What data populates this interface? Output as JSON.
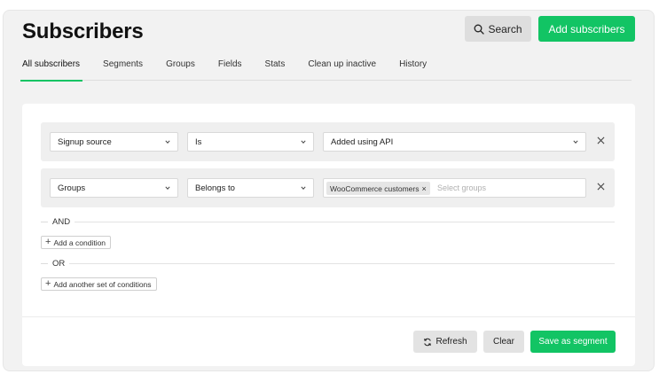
{
  "header": {
    "title": "Subscribers",
    "search_label": "Search",
    "add_label": "Add subscribers"
  },
  "tabs": [
    {
      "label": "All subscribers",
      "active": true
    },
    {
      "label": "Segments"
    },
    {
      "label": "Groups"
    },
    {
      "label": "Fields"
    },
    {
      "label": "Stats"
    },
    {
      "label": "Clean up inactive"
    },
    {
      "label": "History"
    }
  ],
  "conditions": [
    {
      "field": "Signup source",
      "operator": "Is",
      "value": "Added using API"
    },
    {
      "field": "Groups",
      "operator": "Belongs to",
      "tag": "WooCommerce customers",
      "placeholder": "Select groups"
    }
  ],
  "logic": {
    "and_label": "AND",
    "add_condition": "Add a condition",
    "or_label": "OR",
    "add_set": "Add another set of conditions"
  },
  "footer": {
    "refresh_label": "Refresh",
    "clear_label": "Clear",
    "save_label": "Save as segment"
  },
  "colors": {
    "accent": "#12c464",
    "background": "#f2f2f2"
  },
  "icons": {
    "search": "search-icon",
    "refresh": "refresh-icon",
    "remove": "close-icon",
    "dropdown": "chevron-down-icon",
    "add": "plus-icon"
  }
}
